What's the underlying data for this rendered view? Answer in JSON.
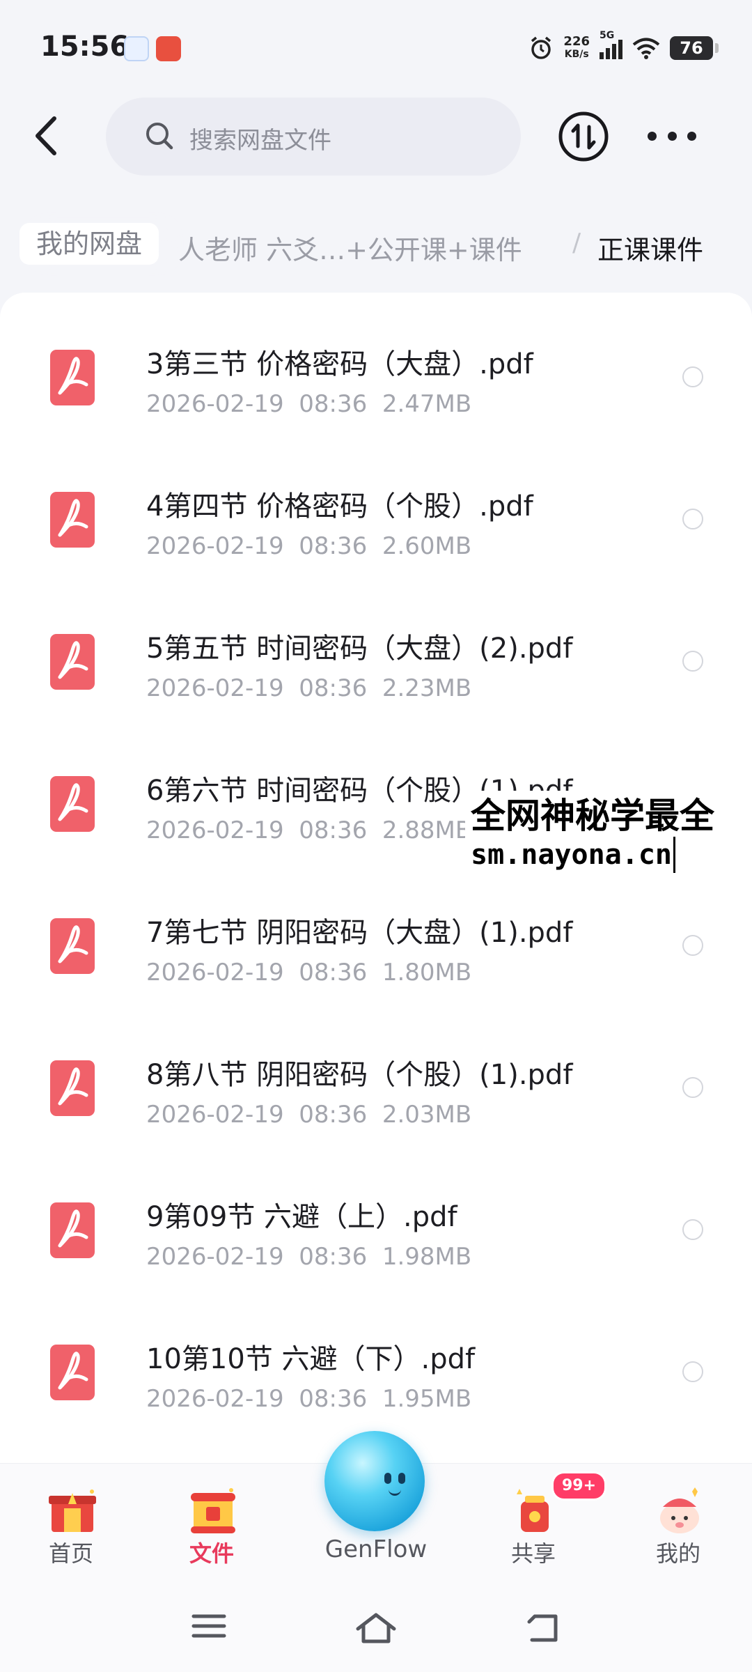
{
  "status_bar": {
    "time": "15:56",
    "net_speed_value": "226",
    "net_speed_unit": "KB/s",
    "network": "5G",
    "battery": "76"
  },
  "header": {
    "search_placeholder": "搜索网盘文件"
  },
  "breadcrumb": {
    "root": "我的网盘",
    "middle": "人老师 六爻…+公开课+课件",
    "separator": "/",
    "current": "正课课件"
  },
  "files": [
    {
      "name": "3第三节   价格密码（大盘）.pdf",
      "date": "2026-02-19",
      "time": "08:36",
      "size": "2.47MB"
    },
    {
      "name": "4第四节   价格密码（个股）.pdf",
      "date": "2026-02-19",
      "time": "08:36",
      "size": "2.60MB"
    },
    {
      "name": "5第五节   时间密码（大盘）(2).pdf",
      "date": "2026-02-19",
      "time": "08:36",
      "size": "2.23MB"
    },
    {
      "name": "6第六节   时间密码（个股）(1).pdf",
      "date": "2026-02-19",
      "time": "08:36",
      "size": "2.88MB"
    },
    {
      "name": "7第七节   阴阳密码（大盘）(1).pdf",
      "date": "2026-02-19",
      "time": "08:36",
      "size": "1.80MB"
    },
    {
      "name": "8第八节   阴阳密码（个股）(1).pdf",
      "date": "2026-02-19",
      "time": "08:36",
      "size": "2.03MB"
    },
    {
      "name": "9第09节 六避（上）.pdf",
      "date": "2026-02-19",
      "time": "08:36",
      "size": "1.98MB"
    },
    {
      "name": "10第10节 六避（下）.pdf",
      "date": "2026-02-19",
      "time": "08:36",
      "size": "1.95MB"
    }
  ],
  "watermark": {
    "line1": "全网神秘学最全",
    "line2": "sm.nayona.cn"
  },
  "tabbar": {
    "home": "首页",
    "files": "文件",
    "genflow": "GenFlow",
    "share": "共享",
    "share_badge": "99+",
    "mine": "我的"
  },
  "colors": {
    "accent": "#e83a5c",
    "pdf_red": "#f0616a",
    "meta_gray": "#a3a5ad"
  }
}
